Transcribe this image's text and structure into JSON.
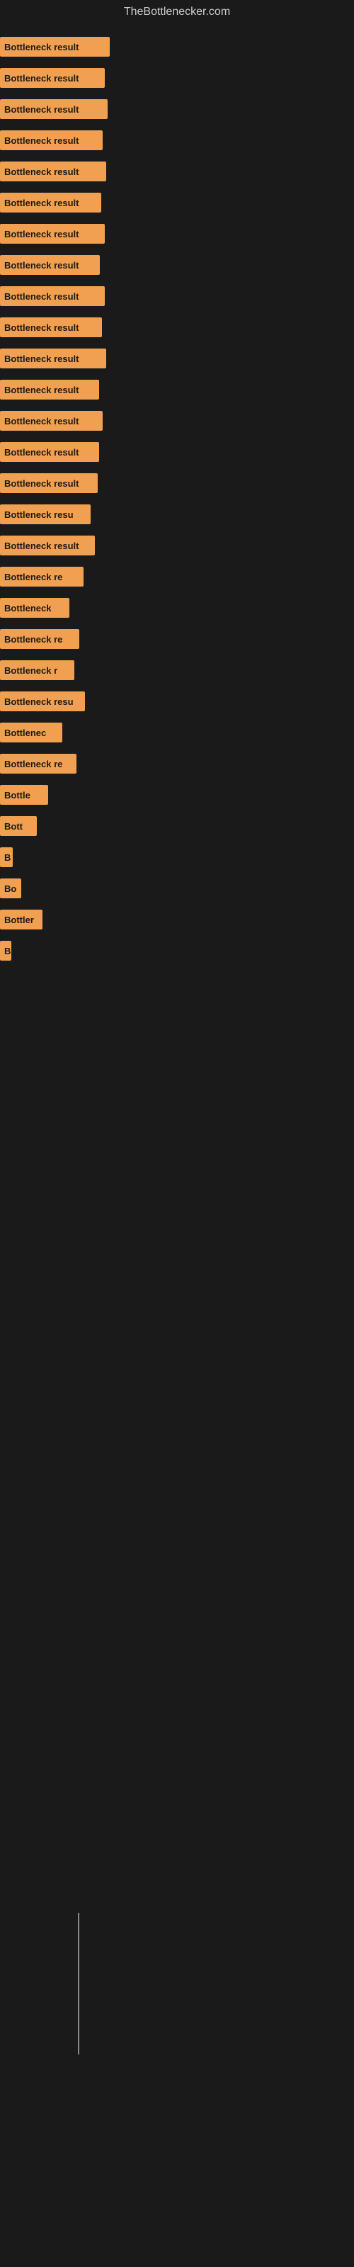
{
  "site": {
    "title": "TheBottlenecker.com"
  },
  "bars": [
    {
      "label": "Bottleneck result",
      "width": 155
    },
    {
      "label": "Bottleneck result",
      "width": 148
    },
    {
      "label": "Bottleneck result",
      "width": 152
    },
    {
      "label": "Bottleneck result",
      "width": 145
    },
    {
      "label": "Bottleneck result",
      "width": 150
    },
    {
      "label": "Bottleneck result",
      "width": 143
    },
    {
      "label": "Bottleneck result",
      "width": 148
    },
    {
      "label": "Bottleneck result",
      "width": 141
    },
    {
      "label": "Bottleneck result",
      "width": 148
    },
    {
      "label": "Bottleneck result",
      "width": 144
    },
    {
      "label": "Bottleneck result",
      "width": 150
    },
    {
      "label": "Bottleneck result",
      "width": 140
    },
    {
      "label": "Bottleneck result",
      "width": 145
    },
    {
      "label": "Bottleneck result",
      "width": 140
    },
    {
      "label": "Bottleneck result",
      "width": 138
    },
    {
      "label": "Bottleneck resu",
      "width": 128
    },
    {
      "label": "Bottleneck result",
      "width": 134
    },
    {
      "label": "Bottleneck re",
      "width": 118
    },
    {
      "label": "Bottleneck",
      "width": 98
    },
    {
      "label": "Bottleneck re",
      "width": 112
    },
    {
      "label": "Bottleneck r",
      "width": 105
    },
    {
      "label": "Bottleneck resu",
      "width": 120
    },
    {
      "label": "Bottlenec",
      "width": 88
    },
    {
      "label": "Bottleneck re",
      "width": 108
    },
    {
      "label": "Bottle",
      "width": 68
    },
    {
      "label": "Bott",
      "width": 52
    },
    {
      "label": "B",
      "width": 18
    },
    {
      "label": "Bo",
      "width": 30
    },
    {
      "label": "Bottler",
      "width": 60
    },
    {
      "label": "B",
      "width": 16
    }
  ]
}
